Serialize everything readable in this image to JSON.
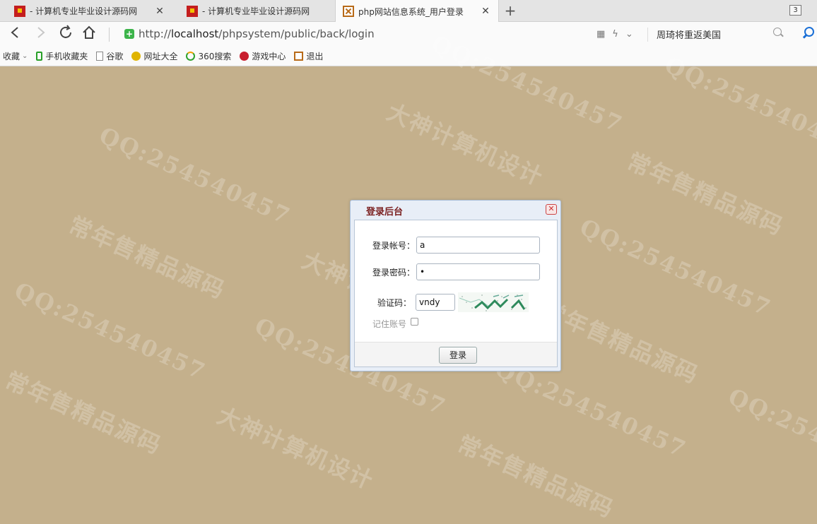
{
  "tabs": [
    {
      "title": "- 计算机专业毕业设计源码网",
      "active": false
    },
    {
      "title": "- 计算机专业毕业设计源码网",
      "active": false
    },
    {
      "title": "php网站信息系统_用户登录",
      "active": true
    }
  ],
  "tab_count": "3",
  "address": {
    "url_prefix": "http://",
    "url_host": "localhost",
    "url_path": "/phpsystem/public/back/login"
  },
  "search": {
    "hint": "周琦将重返美国"
  },
  "bookmarks": [
    "收藏",
    "手机收藏夹",
    "谷歌",
    "网址大全",
    "360搜索",
    "游戏中心",
    "退出"
  ],
  "watermarks": [
    "QQ:254540457",
    "常年售精品源码",
    "大神计算机设计"
  ],
  "dialog": {
    "title": "登录后台",
    "close": "✕",
    "account_label": "登录帐号：",
    "account_value": "a",
    "password_label": "登录密码：",
    "password_value": "•",
    "captcha_label": "验证码：",
    "captcha_value": "vndy",
    "remember_label": "记住账号",
    "submit_label": "登录"
  },
  "colors": {
    "page_bg": "#c4b08c",
    "dialog_title": "#7a1f1f",
    "shield": "#3cb44a",
    "search_accent": "#1a6fd6"
  }
}
